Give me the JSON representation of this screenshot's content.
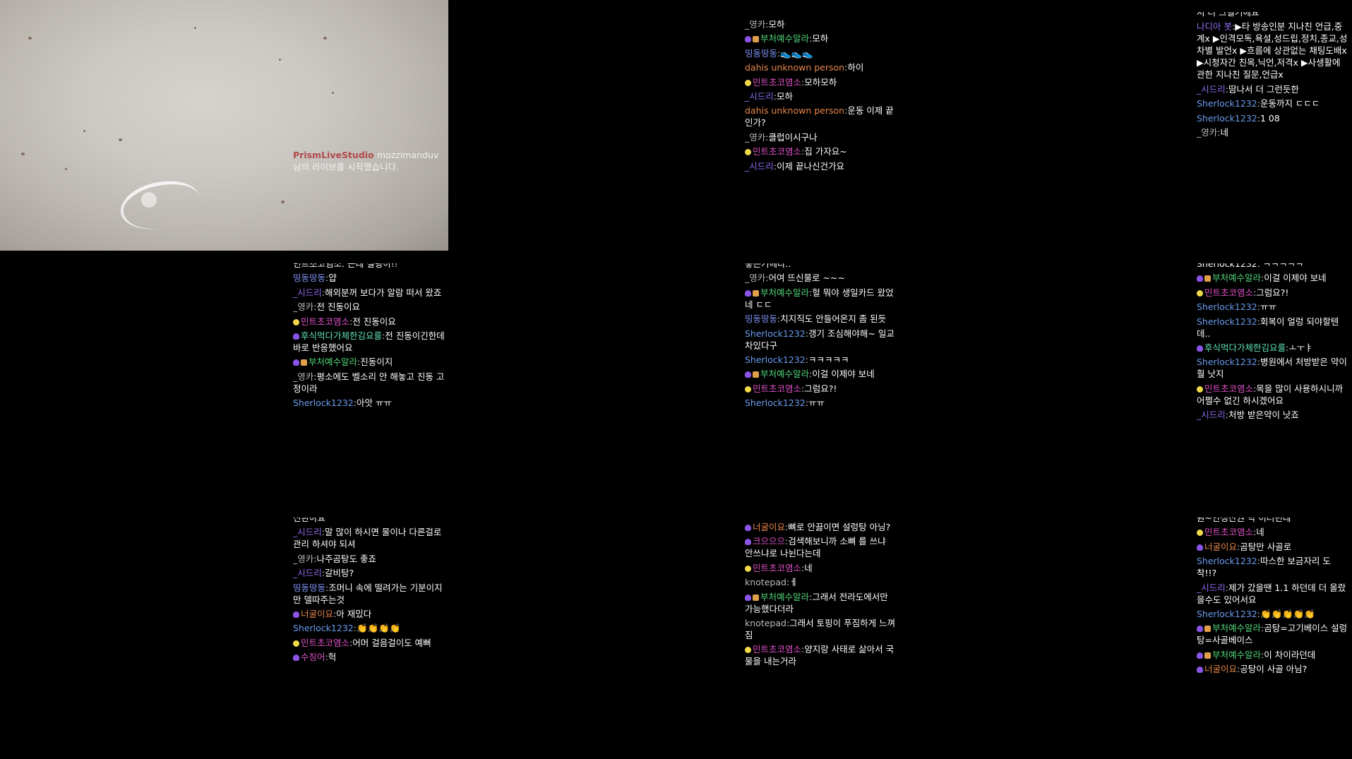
{
  "camera": {
    "system_name": "PrismLiveStudio",
    "notice": "mozzimanduv님의 라이브를 시작했습니다."
  },
  "colors": {
    "pink": "#e052c8",
    "green": "#52d67a",
    "blue": "#7b8ef0",
    "orange": "#e8864a",
    "gray": "#b9b9b9",
    "mint": "#5fe0b0",
    "violet": "#8f6cf0",
    "sky": "#6a9cf0"
  },
  "panels": [
    {
      "id": "c1",
      "messages": [
        {
          "name": "_영카",
          "color": "#b9b9b9",
          "text": "모하"
        },
        {
          "name": "부처예수알라",
          "color": "#52d67a",
          "badges": [
            "heart",
            "trophy"
          ],
          "text": "모하"
        },
        {
          "name": "띵동땅동",
          "color": "#7b8ef0",
          "text": "👟👟👟"
        },
        {
          "name": "dahis unknown person",
          "color": "#e8864a",
          "text": "하이"
        },
        {
          "name": "민트초코염소",
          "color": "#e052c8",
          "badges": [
            "lemon"
          ],
          "text": "모하모하"
        },
        {
          "name": "_시드리",
          "color": "#8f6cf0",
          "text": "모하"
        },
        {
          "name": "dahis unknown person",
          "color": "#e8864a",
          "text": "운동 이제 끝인가?"
        },
        {
          "name": "_영카",
          "color": "#b9b9b9",
          "text": "클럽이시구나"
        },
        {
          "name": "민트초코염소",
          "color": "#e052c8",
          "badges": [
            "lemon"
          ],
          "text": "집 가자요~"
        },
        {
          "name": "_시드리",
          "color": "#8f6cf0",
          "text": "이제 끝나신건가요"
        }
      ]
    },
    {
      "id": "c2",
      "top_fragment": "서 더 그럴거에요",
      "messages": [
        {
          "name": "나디아 봇",
          "color": "#8f6cf0",
          "text": "▶타 방송인분 지나친 언급,중계x ▶인격모독,욕설,성드립,정치,종교,성차별 발언x ▶흐름에 상관없는 채팅도배x ▶시청자간 친목,닉언,저격x ▶사생활에 관한 지나친 질문,언급x"
        },
        {
          "name": "_시드리",
          "color": "#8f6cf0",
          "text": "땀나서 더 그런듯한"
        },
        {
          "name": "Sherlock1232",
          "color": "#6a9cf0",
          "text": "운동까지 ㄷㄷㄷ"
        },
        {
          "name": "Sherlock1232",
          "color": "#6a9cf0",
          "text": "1 08"
        },
        {
          "name": "_영카",
          "color": "#b9b9b9",
          "text": "네"
        }
      ]
    },
    {
      "id": "c3",
      "top_fragment": "민트초코염소: 근데 설렁이!!",
      "messages": [
        {
          "name": "띵동땅동",
          "color": "#7b8ef0",
          "text": "얍"
        },
        {
          "name": "_시드리",
          "color": "#8f6cf0",
          "text": "해외분꺼 보다가 알람 떠서 왔죠"
        },
        {
          "name": "_영카",
          "color": "#b9b9b9",
          "text": "전 진동이요"
        },
        {
          "name": "민트초코염소",
          "color": "#e052c8",
          "badges": [
            "lemon"
          ],
          "text": "전 진동이요"
        },
        {
          "name": "후식먹다가체한김요룰",
          "color": "#5fe0b0",
          "badges": [
            "heart"
          ],
          "text": "전 진동이긴한데 바로 반응했어요"
        },
        {
          "name": "부처예수알라",
          "color": "#52d67a",
          "badges": [
            "heart",
            "trophy"
          ],
          "text": "진동이지"
        },
        {
          "name": "_영카",
          "color": "#b9b9b9",
          "text": "평소에도 벨소리 안 해놓고 진동 고정이라"
        },
        {
          "name": "Sherlock1232",
          "color": "#6a9cf0",
          "text": "아앗 ㅠㅠ"
        }
      ]
    },
    {
      "id": "c4",
      "top_fragment": "좋은거에다..",
      "messages": [
        {
          "name": "_영카",
          "color": "#b9b9b9",
          "text": "어여 뜨신물로 ~~~"
        },
        {
          "name": "부처예수알라",
          "color": "#52d67a",
          "badges": [
            "heart",
            "trophy"
          ],
          "text": "헐 뭐야 생일카드 왔었네 ㄷㄷ"
        },
        {
          "name": "띵동땅동",
          "color": "#7b8ef0",
          "text": "치지직도 안들어온지 좀 된듯"
        },
        {
          "name": "Sherlock1232",
          "color": "#6a9cf0",
          "text": "갱기 조심해야해~ 일교차있다구"
        },
        {
          "name": "Sherlock1232",
          "color": "#6a9cf0",
          "text": "ㅋㅋㅋㅋㅋ"
        },
        {
          "name": "부처예수알라",
          "color": "#52d67a",
          "badges": [
            "heart",
            "trophy"
          ],
          "text": "이걸 이제야 보네"
        },
        {
          "name": "민트초코염소",
          "color": "#e052c8",
          "badges": [
            "lemon"
          ],
          "text": "그럼요?!"
        },
        {
          "name": "Sherlock1232",
          "color": "#6a9cf0",
          "text": "ㅠㅠ"
        }
      ]
    },
    {
      "id": "c5",
      "top_fragment": "Sherlock1232: ㅋㅋㅋㅋㅋ",
      "messages": [
        {
          "name": "부처예수알라",
          "color": "#52d67a",
          "badges": [
            "heart",
            "trophy"
          ],
          "text": "이걸 이제야 보네"
        },
        {
          "name": "민트초코염소",
          "color": "#e052c8",
          "badges": [
            "lemon"
          ],
          "text": "그럼요?!"
        },
        {
          "name": "Sherlock1232",
          "color": "#6a9cf0",
          "text": "ㅠㅠ"
        },
        {
          "name": "Sherlock1232",
          "color": "#6a9cf0",
          "text": "회복이 얼렁 되야할텐데.."
        },
        {
          "name": "후식먹다가체한김요룰",
          "color": "#5fe0b0",
          "badges": [
            "heart"
          ],
          "text": "ㅗㅜㅑ"
        },
        {
          "name": "Sherlock1232",
          "color": "#6a9cf0",
          "text": "병원에서 처방받은 약이 훨 낫지"
        },
        {
          "name": "민트초코염소",
          "color": "#e052c8",
          "badges": [
            "lemon"
          ],
          "text": "목을 많이 사용하시니까 어쩔수 없긴 하시겠어요"
        },
        {
          "name": "_시드리",
          "color": "#8f6cf0",
          "text": "처방 받은약이 낫죠"
        }
      ]
    },
    {
      "id": "c6",
      "top_fragment": "신완아요",
      "messages": [
        {
          "name": "_시드리",
          "color": "#8f6cf0",
          "text": "말 많이 하시면 물이나 다른걸로 관리 하셔야 되셔"
        },
        {
          "name": "_영카",
          "color": "#b9b9b9",
          "text": "나주곰탕도 좋죠"
        },
        {
          "name": "_시드리",
          "color": "#8f6cf0",
          "text": "갈비탕?"
        },
        {
          "name": "띵동땅동",
          "color": "#7b8ef0",
          "text": "조머니 속에 떨려가는 기분이지만 델따주는것"
        },
        {
          "name": "너굴이요",
          "color": "#e8864a",
          "badges": [
            "heart"
          ],
          "text": "아 재밌다"
        },
        {
          "name": "Sherlock1232",
          "color": "#6a9cf0",
          "text": "👏👏👏👏"
        },
        {
          "name": "민트초코염소",
          "color": "#e052c8",
          "badges": [
            "lemon"
          ],
          "text": "어머 걸음걸이도 예뻐"
        },
        {
          "name": "수징어",
          "color": "#e052c8",
          "badges": [
            "heart"
          ],
          "text": "헉"
        }
      ]
    },
    {
      "id": "c7",
      "messages": [
        {
          "name": "너굴이요",
          "color": "#e8864a",
          "badges": [
            "heart"
          ],
          "text": "뼈로 안끓이면 설렁탕 아닝?"
        },
        {
          "name": "크으으으",
          "color": "#e052c8",
          "badges": [
            "heart"
          ],
          "text": "검색해보니까 소뼈 를 쓰냐 안쓰냐로 나뉜다는데"
        },
        {
          "name": "민트초코염소",
          "color": "#e052c8",
          "badges": [
            "lemon"
          ],
          "text": "네"
        },
        {
          "name": "knotepad",
          "color": "#b9b9b9",
          "text": "ㅔ"
        },
        {
          "name": "부처예수알라",
          "color": "#52d67a",
          "badges": [
            "heart",
            "trophy"
          ],
          "text": "그래서 전라도에서만 가능했다더라"
        },
        {
          "name": "knotepad",
          "color": "#b9b9b9",
          "text": "그래서 토핑이 푸짐하게 느껴짐"
        },
        {
          "name": "민트초코염소",
          "color": "#e052c8",
          "badges": [
            "lemon"
          ],
          "text": "양지랑 사태로 삶아서 국물을 내는거라"
        }
      ]
    },
    {
      "id": "c8",
      "top_fragment": "원~안성산권 막 이러던데",
      "messages": [
        {
          "name": "민트초코염소",
          "color": "#e052c8",
          "badges": [
            "lemon"
          ],
          "text": "네"
        },
        {
          "name": "너굴이요",
          "color": "#e8864a",
          "badges": [
            "heart"
          ],
          "text": "곰탕만 사골로"
        },
        {
          "name": "Sherlock1232",
          "color": "#6a9cf0",
          "text": "따스한 보금자리 도착!!?"
        },
        {
          "name": "_시드리",
          "color": "#8f6cf0",
          "text": "제가 갔을땐 1.1 하던데 더 올랐을수도 있어서요"
        },
        {
          "name": "Sherlock1232",
          "color": "#6a9cf0",
          "text": "👏👏👏👏👏"
        },
        {
          "name": "부처예수알라",
          "color": "#52d67a",
          "badges": [
            "heart",
            "trophy"
          ],
          "text": "곰탕=고기베이스 설렁탕=사골베이스"
        },
        {
          "name": "부처예수알라",
          "color": "#52d67a",
          "badges": [
            "heart",
            "trophy"
          ],
          "text": "이 차이라던데"
        },
        {
          "name": "너굴이요",
          "color": "#e8864a",
          "badges": [
            "heart"
          ],
          "text": "공탕이 사골 아님?"
        }
      ]
    }
  ]
}
